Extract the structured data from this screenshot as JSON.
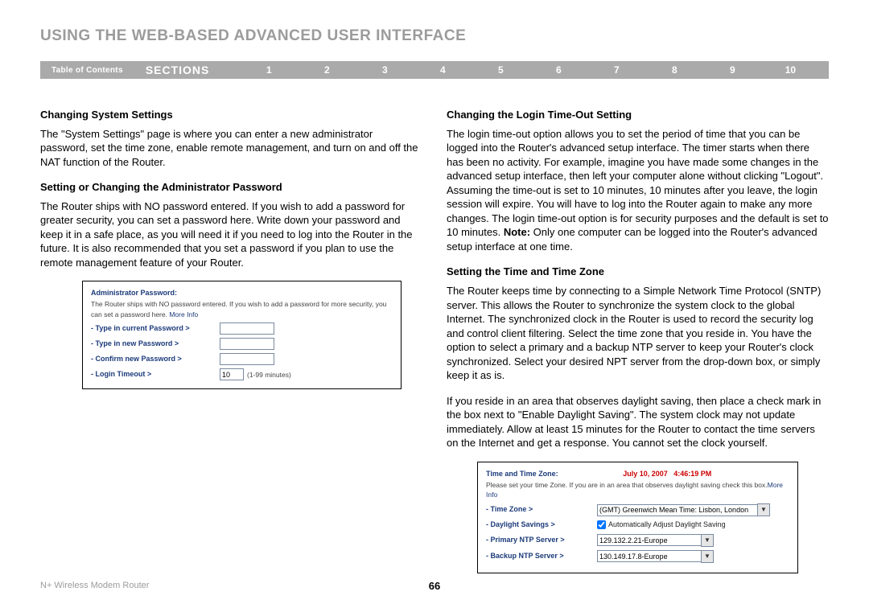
{
  "pageTitle": "USING THE WEB-BASED ADVANCED USER INTERFACE",
  "nav": {
    "toc": "Table of Contents",
    "sectionsLabel": "SECTIONS",
    "sections": [
      "1",
      "2",
      "3",
      "4",
      "5",
      "6",
      "7",
      "8",
      "9",
      "10"
    ],
    "current": "6"
  },
  "left": {
    "h1": "Changing System Settings",
    "p1": "The \"System Settings\" page is where you can enter a new administrator password, set the time zone, enable remote management, and turn on and off the NAT function of the Router.",
    "h2": "Setting or Changing the Administrator Password",
    "p2": "The Router ships with NO password entered. If you wish to add a password for greater security, you can set a password here. Write down your password and keep it in a safe place, as you will need it if you need to log into the Router in the future. It is also recommended that you set a password if you plan to use the remote management feature of your Router.",
    "card": {
      "title": "Administrator Password:",
      "hint": "The Router ships with NO password entered. If you wish to add a password for more security, you can set a password here. ",
      "moreInfo": "More Info",
      "row1": "- Type in current Password >",
      "row2": "- Type in new Password >",
      "row3": "- Confirm new Password >",
      "row4": "- Login Timeout >",
      "timeoutValue": "10",
      "timeoutUnits": "(1-99 minutes)"
    }
  },
  "right": {
    "h1": "Changing the Login Time-Out Setting",
    "p1": "The login time-out option allows you to set the period of time that you can be logged into the Router's advanced setup interface. The timer starts when there has been no activity. For example, imagine you have made some changes in the advanced setup interface, then left your computer alone without clicking \"Logout\". Assuming the time-out is set to 10 minutes, 10 minutes after you leave, the login session will expire. You will have to log into the Router again to make any more changes. The login time-out option is for security purposes and the default is set to 10 minutes. ",
    "p1note": "Note:",
    "p1b": " Only one computer can be logged into the Router's advanced setup interface at one time.",
    "h2": "Setting the Time and Time Zone",
    "p2": "The Router keeps time by connecting to a Simple Network Time Protocol (SNTP) server. This allows the Router to synchronize the system clock to the global Internet. The synchronized clock in the Router is used to record the security log and control client filtering. Select the time zone that you reside in. You have the option to select a primary and a backup NTP server to keep your Router's clock synchronized. Select your desired NPT server from the drop-down box, or simply keep it as is.",
    "p3": "If you reside in an area that observes daylight saving, then place a check mark in the box next to \"Enable Daylight Saving\". The system clock may not update immediately. Allow at least 15 minutes for the Router to contact the time servers on the Internet and get a response. You cannot set the clock yourself.",
    "card": {
      "title": "Time and Time Zone:",
      "datetime": "July 10, 2007   4:46:19 PM",
      "hint": "Please set your time Zone. If you are in an area that observes daylight saving check this box.",
      "moreInfo": "More Info",
      "row1": "- Time Zone >",
      "tzValue": "(GMT) Greenwich Mean Time: Lisbon, London",
      "row2": "- Daylight Savings >",
      "dsLabel": "Automatically Adjust Daylight Saving",
      "row3": "- Primary NTP Server >",
      "primary": "129.132.2.21-Europe",
      "row4": "- Backup NTP Server >",
      "backup": "130.149.17.8-Europe"
    }
  },
  "footer": {
    "product": "N+ Wireless Modem Router",
    "pageNum": "66"
  }
}
